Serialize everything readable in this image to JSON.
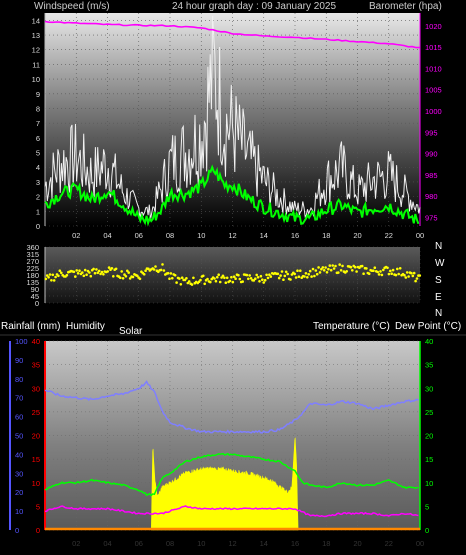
{
  "header": {
    "windspeed_label": "Windspeed (m/s)",
    "title": "24 hour graph day : 09 January 2025",
    "barometer_label": "Barometer (hpa)"
  },
  "mid_header": {
    "rainfall_label": "Rainfall (mm)",
    "humidity_label": "Humidity",
    "solar_label": "Solar",
    "temperature_label": "Temperature (°C)",
    "dewpoint_label": "Dew Point (°C)"
  },
  "compass_labels": [
    "N",
    "W",
    "S",
    "E",
    "N"
  ],
  "colors": {
    "gust": "#f0f0f0",
    "wind": "#00ff00",
    "barometer": "#ff00ff",
    "direction": "#ffff00",
    "humidity": "#7f7fff",
    "temperature": "#00ff00",
    "dewpoint": "#ff00ff",
    "solar": "#ffff00",
    "rain_axis": "#ff0000",
    "humidity_axis": "#5555ff",
    "green_axis": "#00ff00"
  },
  "chart_data": [
    {
      "type": "line",
      "title": "24 hour graph day : 09 January 2025",
      "xlabel": "",
      "x_ticks": [
        "02",
        "04",
        "06",
        "08",
        "10",
        "12",
        "14",
        "16",
        "18",
        "20",
        "22",
        "00"
      ],
      "ylabel": "Windspeed (m/s)",
      "ylim": [
        0,
        14.5
      ],
      "y_ticks": [
        0,
        1,
        2,
        3,
        4,
        5,
        6,
        7,
        8,
        9,
        10,
        11,
        12,
        13,
        14
      ],
      "y2label": "Barometer (hpa)",
      "y2lim": [
        973,
        1023
      ],
      "y2_ticks": [
        975,
        980,
        985,
        990,
        995,
        1000,
        1005,
        1010,
        1015,
        1020
      ],
      "grid": true,
      "series": [
        {
          "name": "Windspeed (m/s)",
          "x": [
            0,
            1,
            2,
            3,
            4,
            5,
            6,
            6.8,
            7.5,
            8,
            9,
            10,
            10.8,
            11.5,
            12,
            13,
            14,
            15,
            16,
            17,
            18,
            19,
            20,
            21,
            22,
            23,
            24
          ],
          "y": [
            1.5,
            2.2,
            2.5,
            1.8,
            2.4,
            1.5,
            0.5,
            0.4,
            1.2,
            2.2,
            2.2,
            2.7,
            3.8,
            2.8,
            2.8,
            1.9,
            1.3,
            0.9,
            0.5,
            0.5,
            1.1,
            1.4,
            0.9,
            1.2,
            1.4,
            0.8,
            0.3
          ]
        },
        {
          "name": "Gust",
          "x": [
            0,
            1,
            2,
            3,
            4,
            5,
            6,
            6.8,
            7.5,
            8,
            9,
            10,
            10.8,
            11.5,
            12,
            13,
            14,
            15,
            16,
            17,
            18,
            19,
            20,
            21,
            22,
            23,
            24
          ],
          "y": [
            3.5,
            5.5,
            6.0,
            4.5,
            5.5,
            3.0,
            1.5,
            1.2,
            3.5,
            5.5,
            6.5,
            8.0,
            13.5,
            9.0,
            8.5,
            6.0,
            4.0,
            2.5,
            1.5,
            1.5,
            4.0,
            5.0,
            3.0,
            4.0,
            4.5,
            3.0,
            1.5
          ]
        },
        {
          "name": "Barometer (hpa)",
          "x": [
            0,
            2,
            4,
            6,
            8,
            10,
            12,
            14,
            16,
            18,
            20,
            22,
            24
          ],
          "y": [
            1021,
            1020.6,
            1020.3,
            1020.1,
            1020,
            1019.5,
            1018.2,
            1017.6,
            1017.3,
            1016.8,
            1016.3,
            1015.8,
            1014.8
          ]
        }
      ]
    },
    {
      "type": "scatter",
      "title": "",
      "xlabel": "",
      "ylabel": "",
      "ylim": [
        0,
        360
      ],
      "y_ticks": [
        0,
        45,
        90,
        135,
        180,
        225,
        270,
        315,
        360
      ],
      "y_right_labels": [
        "N",
        "W",
        "S",
        "E",
        "N"
      ],
      "grid": true,
      "series": [
        {
          "name": "",
          "x": [
            0,
            1,
            2,
            3,
            4,
            5,
            6,
            6.8,
            7.5,
            8,
            9,
            10,
            11,
            12,
            13,
            14,
            15,
            16,
            17,
            18,
            19,
            20,
            21,
            22,
            23,
            24
          ],
          "y": [
            145,
            190,
            190,
            195,
            205,
            185,
            175,
            230,
            225,
            165,
            135,
            148,
            158,
            155,
            162,
            158,
            175,
            180,
            195,
            210,
            225,
            215,
            205,
            210,
            195,
            150
          ]
        }
      ]
    },
    {
      "type": "line",
      "title": "",
      "xlabel": "",
      "x_ticks": [
        "02",
        "04",
        "06",
        "08",
        "10",
        "12",
        "14",
        "16",
        "18",
        "20",
        "22",
        "00"
      ],
      "ylabel": "Rainfall (mm)",
      "ylim": [
        0,
        40
      ],
      "y_ticks": [
        0,
        5,
        10,
        15,
        20,
        25,
        30,
        35,
        40
      ],
      "humidity_axis": {
        "label": "Humidity",
        "range": [
          0,
          100
        ],
        "ticks": [
          0,
          10,
          20,
          30,
          40,
          50,
          60,
          70,
          80,
          90,
          100
        ]
      },
      "temperature_axis": {
        "label": "Temperature (°C)",
        "range": [
          0,
          40
        ],
        "ticks": [
          0,
          5,
          10,
          15,
          20,
          25,
          30,
          35,
          40
        ]
      },
      "grid": true,
      "series": [
        {
          "name": "Humidity",
          "axis": "humidity",
          "x": [
            0,
            1,
            2,
            3,
            4,
            5,
            6,
            6.5,
            7,
            7.5,
            8,
            9,
            10,
            11,
            12,
            13,
            14,
            15,
            16,
            16.5,
            17,
            18,
            19,
            20,
            21,
            22,
            23,
            24
          ],
          "y": [
            74,
            71,
            70,
            69,
            71,
            72,
            75,
            78,
            73,
            63,
            57,
            54,
            52,
            52,
            52,
            52,
            52,
            53,
            58,
            62,
            67,
            66,
            68,
            67,
            64,
            66,
            68,
            69
          ]
        },
        {
          "name": "Temperature (°C)",
          "axis": "temperature",
          "x": [
            0,
            1,
            2,
            3,
            4,
            5,
            6,
            6.5,
            7,
            7.5,
            8,
            9,
            10,
            11,
            12,
            13,
            14,
            15,
            16,
            16.5,
            17,
            18,
            19,
            20,
            21,
            22,
            23,
            24
          ],
          "y": [
            8.5,
            10,
            10,
            10.5,
            10,
            9.5,
            8.5,
            7.5,
            7.5,
            11,
            12,
            14.5,
            15.5,
            16,
            16,
            15.5,
            15,
            14.5,
            12.5,
            10,
            9.5,
            9,
            10,
            9.5,
            9.5,
            10.5,
            9,
            9
          ]
        },
        {
          "name": "Dew Point (°C)",
          "axis": "temperature",
          "x": [
            0,
            1,
            2,
            3,
            4,
            5,
            6,
            6.5,
            7,
            7.5,
            8,
            9,
            10,
            11,
            12,
            13,
            14,
            15,
            16,
            17,
            18,
            19,
            20,
            21,
            22,
            23,
            24
          ],
          "y": [
            4,
            5,
            4.5,
            4.5,
            4.5,
            4,
            3.5,
            3.5,
            3.5,
            3.5,
            4,
            5,
            4.5,
            4.5,
            4.5,
            4.5,
            4.5,
            4.5,
            4.5,
            3,
            3,
            3.5,
            3.5,
            3.5,
            3,
            3.5,
            3
          ]
        },
        {
          "name": "Solar",
          "axis": "temperature",
          "x": [
            6.8,
            6.9,
            7.05,
            7.2,
            7.5,
            8,
            8.5,
            9,
            9.5,
            10,
            10.5,
            11,
            11.5,
            12,
            12.5,
            13,
            13.5,
            14,
            14.5,
            15,
            15.5,
            15.8,
            16.0,
            16.1,
            16.2
          ],
          "y": [
            0,
            18,
            10,
            7,
            9,
            10,
            11,
            12,
            12.5,
            12.8,
            13,
            12.9,
            12.8,
            12.5,
            12.2,
            12,
            11.5,
            11,
            10.4,
            9.2,
            8,
            9,
            20,
            14,
            0
          ]
        },
        {
          "name": "Rainfall (mm)",
          "axis": "rain",
          "x": [
            0,
            24
          ],
          "y": [
            0,
            0
          ]
        }
      ]
    }
  ]
}
